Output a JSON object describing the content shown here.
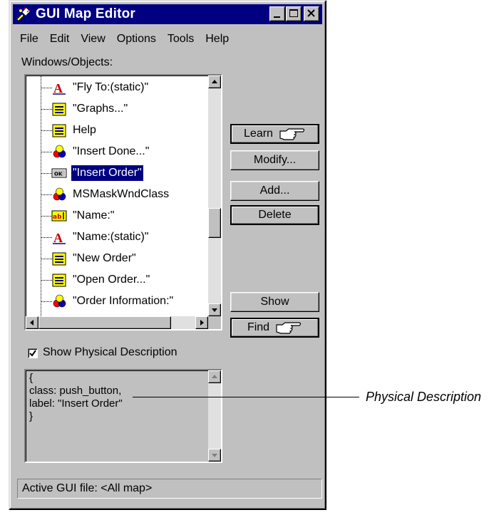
{
  "window": {
    "title": "GUI Map Editor"
  },
  "menu": [
    "File",
    "Edit",
    "View",
    "Options",
    "Tools",
    "Help"
  ],
  "tree": {
    "label": "Windows/Objects:",
    "items": [
      {
        "text": "\"Fly To:(static)\"",
        "icon": "static-text-icon"
      },
      {
        "text": "\"Graphs...\"",
        "icon": "menu-item-icon"
      },
      {
        "text": "Help",
        "icon": "menu-item-icon"
      },
      {
        "text": "\"Insert Done...\"",
        "icon": "object-icon"
      },
      {
        "text": "\"Insert Order\"",
        "icon": "push-button-icon",
        "selected": true
      },
      {
        "text": "MSMaskWndClass",
        "icon": "object-icon"
      },
      {
        "text": "\"Name:\"",
        "icon": "edit-field-icon"
      },
      {
        "text": "\"Name:(static)\"",
        "icon": "static-text-icon"
      },
      {
        "text": "\"New Order\"",
        "icon": "menu-item-icon"
      },
      {
        "text": "\"Open Order...\"",
        "icon": "menu-item-icon"
      },
      {
        "text": "\"Order Information:\"",
        "icon": "object-icon"
      }
    ]
  },
  "buttons": {
    "learn": "Learn",
    "modify": "Modify...",
    "add": "Add...",
    "delete": "Delete",
    "show": "Show",
    "find": "Find"
  },
  "physical": {
    "checkbox_label": "Show Physical Description",
    "checked": true,
    "lines": [
      "{",
      "class: push_button,",
      "label: \"Insert Order\"",
      "}"
    ]
  },
  "status": "Active GUI file: <All map>",
  "callout": "Physical Description",
  "colors": {
    "selection": "#000080",
    "titlebar": "#000080",
    "face": "#c0c0c0"
  }
}
